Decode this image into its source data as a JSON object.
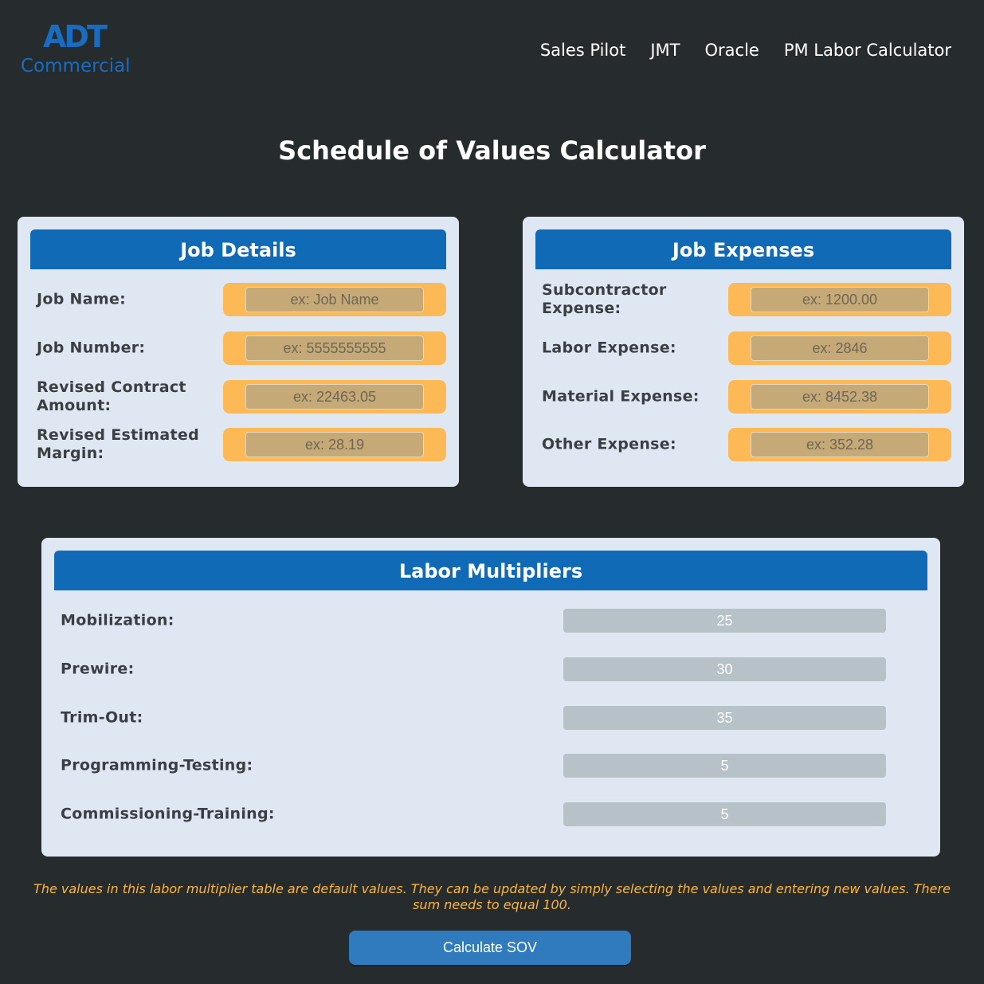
{
  "brand": {
    "logo_mark": "ADT",
    "logo_sub": "Commercial"
  },
  "nav": {
    "sales_pilot": "Sales Pilot",
    "jmt": "JMT",
    "oracle": "Oracle",
    "pm_labor": "PM Labor Calculator"
  },
  "page_title": "Schedule of Values Calculator",
  "job_details": {
    "title": "Job Details",
    "fields": [
      {
        "label": "Job Name:",
        "placeholder": "ex: Job Name",
        "value": ""
      },
      {
        "label": "Job Number:",
        "placeholder": "ex: 5555555555",
        "value": ""
      },
      {
        "label": "Revised Contract Amount:",
        "placeholder": "ex: 22463.05",
        "value": ""
      },
      {
        "label": "Revised Estimated Margin:",
        "placeholder": "ex: 28.19",
        "value": ""
      }
    ]
  },
  "job_expenses": {
    "title": "Job Expenses",
    "fields": [
      {
        "label": "Subcontractor Expense:",
        "placeholder": "ex: 1200.00",
        "value": ""
      },
      {
        "label": "Labor Expense:",
        "placeholder": "ex: 2846",
        "value": ""
      },
      {
        "label": "Material Expense:",
        "placeholder": "ex: 8452.38",
        "value": ""
      },
      {
        "label": "Other Expense:",
        "placeholder": "ex: 352.28",
        "value": ""
      }
    ]
  },
  "labor_multipliers": {
    "title": "Labor Multipliers",
    "rows": [
      {
        "label": "Mobilization:",
        "value": "25"
      },
      {
        "label": "Prewire:",
        "value": "30"
      },
      {
        "label": "Trim-Out:",
        "value": "35"
      },
      {
        "label": "Programming-Testing:",
        "value": "5"
      },
      {
        "label": "Commissioning-Training:",
        "value": "5"
      }
    ]
  },
  "note": "The values in this labor multiplier table are default values. They can be updated by simply selecting the values and entering new values. There sum needs to equal 100.",
  "calculate_button": "Calculate SOV",
  "colors": {
    "background": "#262c2d",
    "brand_blue": "#116ab5",
    "card_bg": "#dfe8f2",
    "field_orange": "#fdb956",
    "note_text": "#fdb53f",
    "button_blue": "#2f7bbd"
  }
}
